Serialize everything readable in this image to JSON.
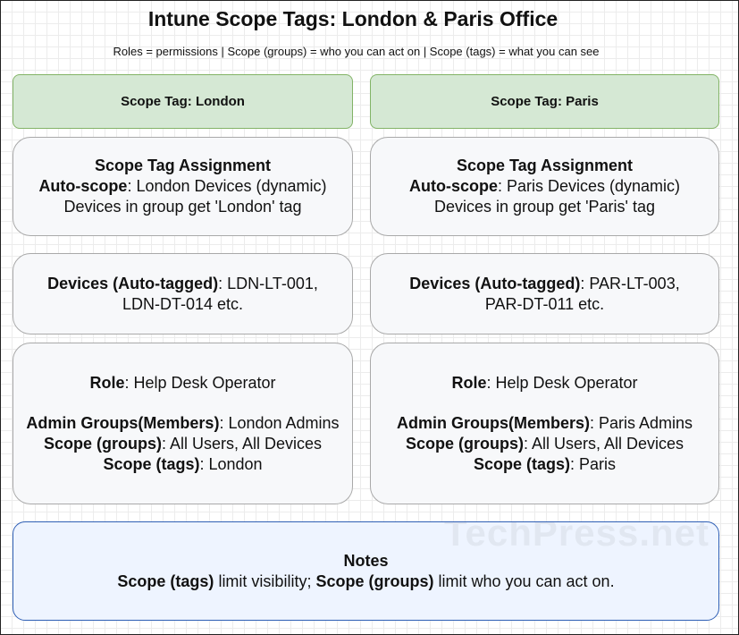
{
  "title": "Intune Scope Tags: London & Paris Office",
  "subtitle": "Roles = permissions | Scope (groups) = who you can act on | Scope (tags) = what you can see",
  "colors": {
    "header_fill": "#d5e8d4",
    "header_border": "#82b366",
    "box_fill": "#f7f8fa",
    "notes_fill": "#eef4ff",
    "notes_border": "#2f5fb5"
  },
  "london": {
    "header": "Scope Tag: London",
    "assignment": {
      "heading": "Scope Tag Assignment",
      "auto_scope_label": "Auto-scope",
      "auto_scope_value": ": London Devices (dynamic)",
      "tag_note": "Devices in group get 'London' tag"
    },
    "devices": {
      "label": "Devices (Auto-tagged)",
      "value_line1": ": LDN-LT-001,",
      "value_line2": "LDN-DT-014 etc."
    },
    "role": {
      "role_label": "Role",
      "role_value": ": Help Desk Operator",
      "admin_label": "Admin Groups(Members)",
      "admin_value": ": London Admins",
      "scope_groups_label": "Scope (groups)",
      "scope_groups_value": ": All Users, All Devices",
      "scope_tags_label": "Scope (tags)",
      "scope_tags_value": ": London"
    }
  },
  "paris": {
    "header": "Scope Tag: Paris",
    "assignment": {
      "heading": "Scope Tag Assignment",
      "auto_scope_label": "Auto-scope",
      "auto_scope_value": ": Paris Devices (dynamic)",
      "tag_note": "Devices in group get 'Paris' tag"
    },
    "devices": {
      "label": "Devices (Auto-tagged)",
      "value_line1": ": PAR-LT-003,",
      "value_line2": "PAR-DT-011 etc."
    },
    "role": {
      "role_label": "Role",
      "role_value": ": Help Desk Operator",
      "admin_label": "Admin Groups(Members)",
      "admin_value": ": Paris Admins",
      "scope_groups_label": "Scope (groups)",
      "scope_groups_value": ": All Users, All Devices",
      "scope_tags_label": "Scope (tags)",
      "scope_tags_value": ": Paris"
    }
  },
  "notes": {
    "heading": "Notes",
    "part1_bold": "Scope (tags)",
    "part2": " limit visibility; ",
    "part3_bold": "Scope (groups)",
    "part4": " limit who you can act on."
  },
  "watermark": "TechPress.net"
}
